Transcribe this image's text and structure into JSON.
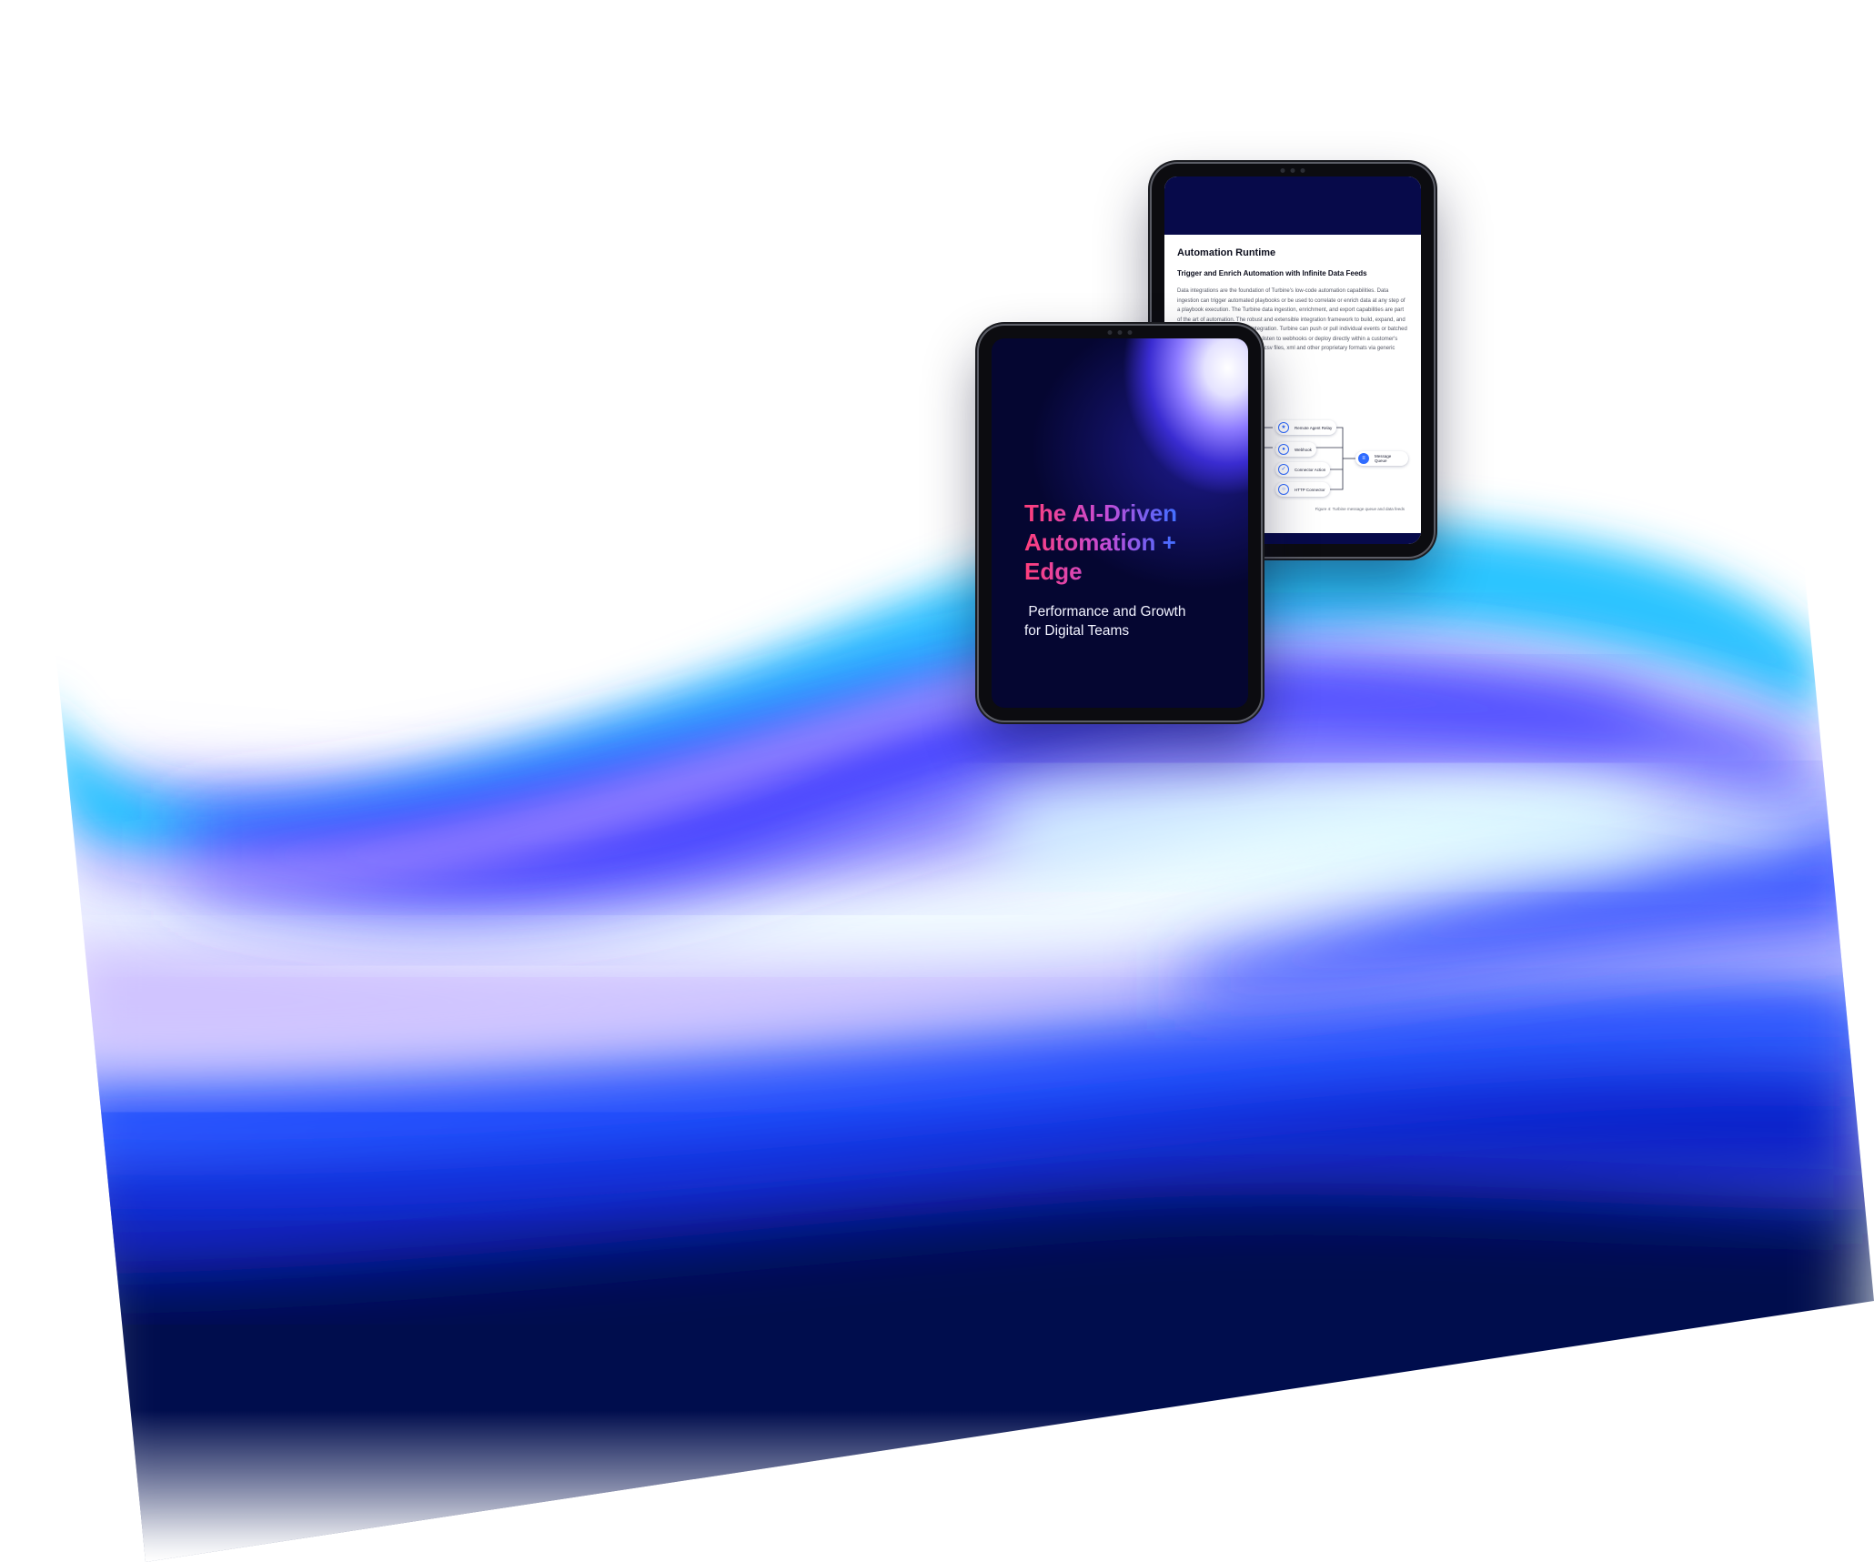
{
  "brand_colors": {
    "deep_navy": "#050631",
    "electric_blue": "#2f6bff",
    "cyan": "#38c9ff",
    "lavender": "#cbb9ff",
    "pink": "#ff3e7a"
  },
  "front_tablet": {
    "cover_title": "The AI-Driven Automation + Edge",
    "cover_subtitle": " Performance and Growth for Digital Teams"
  },
  "back_tablet": {
    "doc_title": "Automation Runtime",
    "doc_subtitle": "Trigger and Enrich Automation with Infinite Data Feeds",
    "doc_paragraph": "Data integrations are the foundation of Turbine's low-code automation capabilities. Data ingestion can trigger automated playbooks or be used to correlate or enrich data at any step of a playbook execution. The Turbine data ingestion, enrichment, and export capabilities are part of the art of automation. The robust and extensible integration framework to build, expand, and customize virtually any kind of integration. Turbine can push or pull individual events or batched data, retrieve based on schedules, listen to webhooks or deploy directly within a customer's infrastructure. It can work with json, csv files, xml and other proprietary formats via generic and/or custom connectors.",
    "figure": {
      "nodes": [
        {
          "label": "Remote Agent Relay",
          "icon": "runner-icon"
        },
        {
          "label": "Webhook",
          "icon": "webhook-icon"
        },
        {
          "label": "Connector Action",
          "icon": "check-icon"
        },
        {
          "label": "HTTP Connector",
          "icon": "globe-icon"
        },
        {
          "label": "Message Queue",
          "icon": "queue-icon"
        }
      ],
      "caption": "Figure 4: Turbine message queue and data feeds"
    }
  }
}
